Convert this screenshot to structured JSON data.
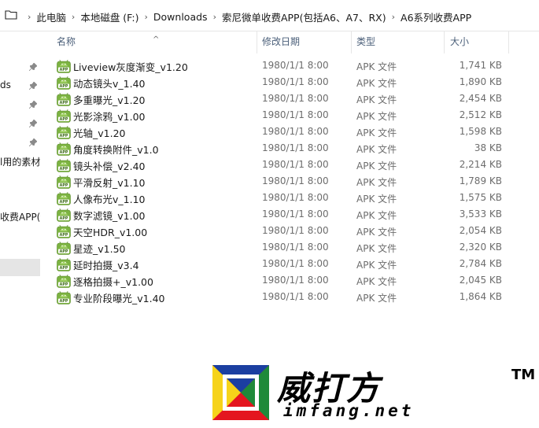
{
  "breadcrumb": {
    "items": [
      "此电脑",
      "本地磁盘 (F:)",
      "Downloads",
      "索尼微单收费APP(包括A6、A7、RX)",
      "A6系列收费APP"
    ],
    "separator": "›"
  },
  "nav": {
    "items": [
      {
        "label": "ds",
        "pinned": true
      },
      {
        "label": "",
        "pinned": true
      },
      {
        "label": "",
        "pinned": true
      },
      {
        "label": "",
        "pinned": true
      },
      {
        "label": "",
        "pinned": true
      },
      {
        "label": "l用的素材",
        "pinned": false
      },
      {
        "label": "收费APP(包",
        "pinned": false
      }
    ]
  },
  "columns": {
    "name": "名称",
    "date": "修改日期",
    "type": "类型",
    "size": "大小",
    "sort_indicator": "^"
  },
  "files": [
    {
      "name": "Liveview灰度渐变_v1.20",
      "date": "1980/1/1 8:00",
      "type": "APK 文件",
      "size": "1,741 KB"
    },
    {
      "name": "动态镜头v_1.40",
      "date": "1980/1/1 8:00",
      "type": "APK 文件",
      "size": "1,890 KB"
    },
    {
      "name": "多重曝光_v1.20",
      "date": "1980/1/1 8:00",
      "type": "APK 文件",
      "size": "2,454 KB"
    },
    {
      "name": "光影涂鸦_v1.00",
      "date": "1980/1/1 8:00",
      "type": "APK 文件",
      "size": "2,512 KB"
    },
    {
      "name": "光轴_v1.20",
      "date": "1980/1/1 8:00",
      "type": "APK 文件",
      "size": "1,598 KB"
    },
    {
      "name": "角度转换附件_v1.0",
      "date": "1980/1/1 8:00",
      "type": "APK 文件",
      "size": "38 KB"
    },
    {
      "name": "镜头补偿_v2.40",
      "date": "1980/1/1 8:00",
      "type": "APK 文件",
      "size": "2,214 KB"
    },
    {
      "name": "平滑反射_v1.10",
      "date": "1980/1/1 8:00",
      "type": "APK 文件",
      "size": "1,789 KB"
    },
    {
      "name": "人像布光v_1.10",
      "date": "1980/1/1 8:00",
      "type": "APK 文件",
      "size": "1,575 KB"
    },
    {
      "name": "数字滤镜_v1.00",
      "date": "1980/1/1 8:00",
      "type": "APK 文件",
      "size": "3,533 KB"
    },
    {
      "name": "天空HDR_v1.00",
      "date": "1980/1/1 8:00",
      "type": "APK 文件",
      "size": "2,054 KB"
    },
    {
      "name": "星迹_v1.50",
      "date": "1980/1/1 8:00",
      "type": "APK 文件",
      "size": "2,320 KB"
    },
    {
      "name": "延时拍摄_v3.4",
      "date": "1980/1/1 8:00",
      "type": "APK 文件",
      "size": "2,784 KB"
    },
    {
      "name": "逐格拍摄+_v1.00",
      "date": "1980/1/1 8:00",
      "type": "APK 文件",
      "size": "2,045 KB"
    },
    {
      "name": "专业阶段曝光_v1.40",
      "date": "1980/1/1 8:00",
      "type": "APK 文件",
      "size": "1,864 KB"
    }
  ],
  "file_icon": {
    "name": "apk-android-icon",
    "label": "APP",
    "color": "#7cb342"
  },
  "watermark": {
    "title": "威打方",
    "trademark": "TM",
    "url": "imfang.net",
    "logo_colors": [
      "#e4161f",
      "#1b3fa1",
      "#f6d31a",
      "#1f8a3a"
    ]
  }
}
